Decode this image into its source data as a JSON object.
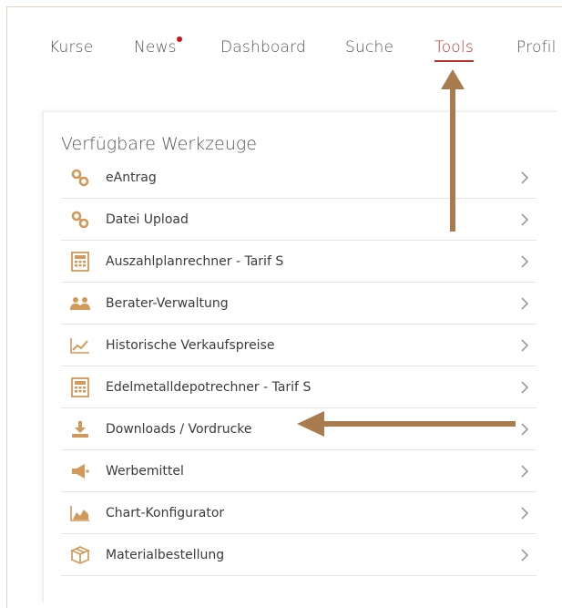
{
  "nav": {
    "items": [
      {
        "label": "Kurse",
        "active": false,
        "badge": false
      },
      {
        "label": "News",
        "active": false,
        "badge": true
      },
      {
        "label": "Dashboard",
        "active": false,
        "badge": false
      },
      {
        "label": "Suche",
        "active": false,
        "badge": false
      },
      {
        "label": "Tools",
        "active": true,
        "badge": false
      },
      {
        "label": "Profil",
        "active": false,
        "badge": false
      }
    ]
  },
  "panel": {
    "title": "Verfügbare Werkzeuge",
    "items": [
      {
        "label": "eAntrag",
        "icon": "link-icon"
      },
      {
        "label": "Datei Upload",
        "icon": "link-icon"
      },
      {
        "label": "Auszahlplanrechner - Tarif S",
        "icon": "calculator-icon"
      },
      {
        "label": "Berater-Verwaltung",
        "icon": "users-icon"
      },
      {
        "label": "Historische Verkaufspreise",
        "icon": "line-chart-icon"
      },
      {
        "label": "Edelmetalldepotrechner - Tarif S",
        "icon": "calculator-icon"
      },
      {
        "label": "Downloads / Vordrucke",
        "icon": "download-icon"
      },
      {
        "label": "Werbemittel",
        "icon": "megaphone-icon"
      },
      {
        "label": "Chart-Konfigurator",
        "icon": "area-chart-icon"
      },
      {
        "label": "Materialbestellung",
        "icon": "box-icon"
      }
    ]
  },
  "colors": {
    "accent": "#c0302a",
    "icon": "#d29a5a",
    "annotation_arrow": "#a87c4e"
  }
}
